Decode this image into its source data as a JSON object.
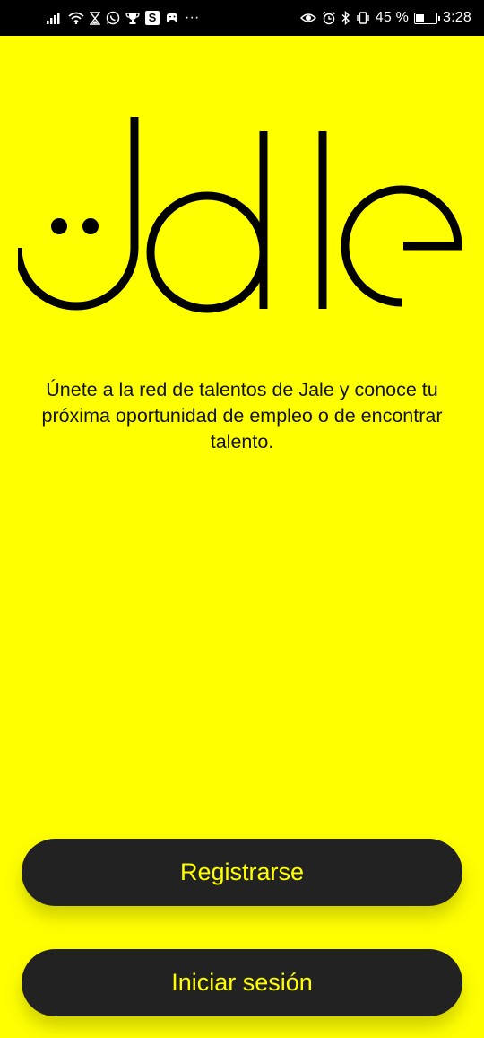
{
  "status_bar": {
    "left_icons": [
      "signal-icon",
      "wifi-icon",
      "hourglass-icon",
      "whatsapp-icon",
      "trophy-icon",
      "s-app-icon",
      "game-icon",
      "more-dots-icon"
    ],
    "s_app_label": "S",
    "more_dots": "···",
    "right_icons": [
      "eye-icon",
      "alarm-icon",
      "bluetooth-icon",
      "vibrate-icon"
    ],
    "battery_percent": "45 %",
    "battery_level": 0.45,
    "time": "3:28"
  },
  "brand": {
    "logo_name": "Jale",
    "logo_color": "#000000",
    "background_color": "#ffff00"
  },
  "tagline": "Únete a la red de talentos de Jale y conoce tu próxima oportunidad de empleo o de encontrar talento.",
  "buttons": {
    "register_label": "Registrarse",
    "login_label": "Iniciar sesión",
    "button_bg": "#222222",
    "button_text_color": "#ffff00"
  }
}
